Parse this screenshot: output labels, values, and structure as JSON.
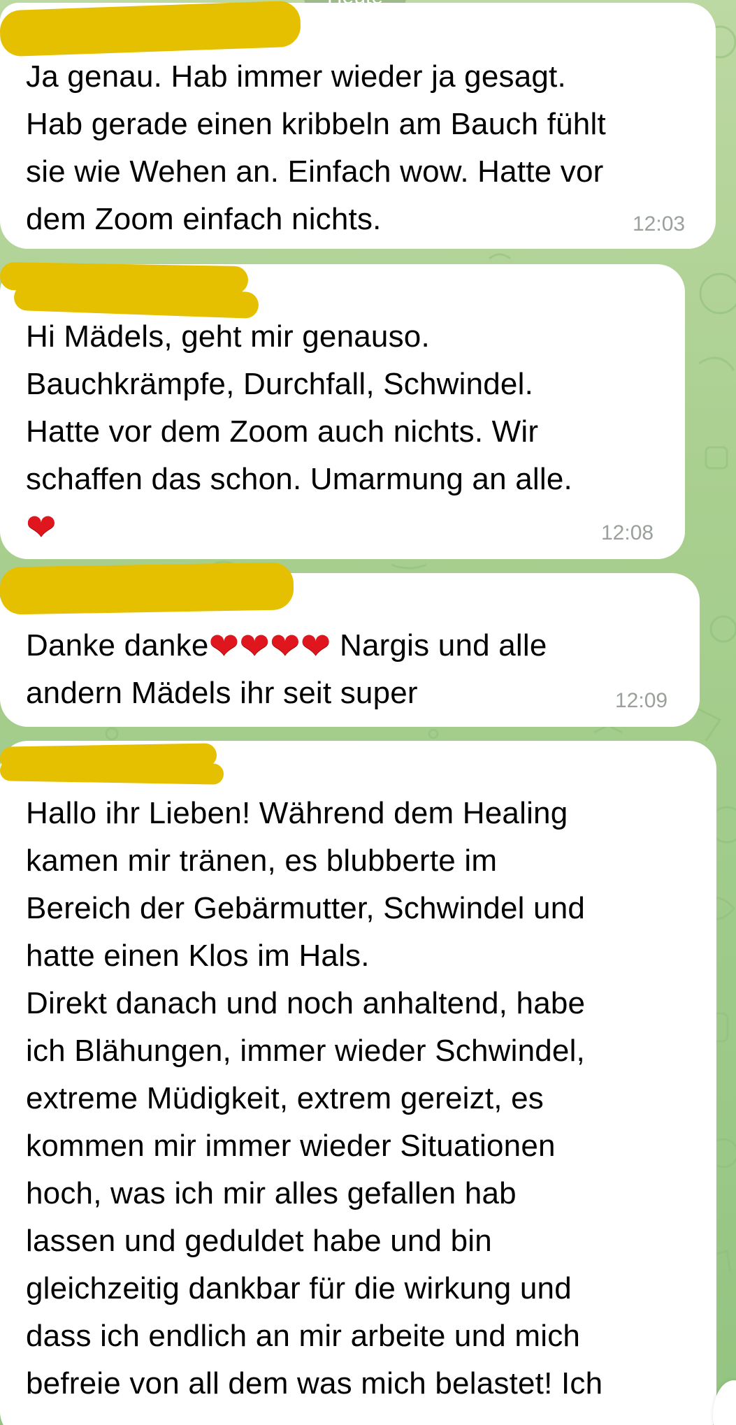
{
  "chat": {
    "background_color": "#a9cf8f",
    "bubble_color": "#ffffff",
    "redaction_color": "#e4c000",
    "header_chip_label": "Heute",
    "messages": [
      {
        "lines": [
          "Ja genau. Hab immer wieder ja gesagt.",
          "Hab gerade einen kribbeln am Bauch fühlt",
          "sie wie Wehen an. Einfach wow. Hatte vor",
          "dem Zoom einfach nichts."
        ],
        "time": "12:03"
      },
      {
        "lines": [
          "Hi Mädels, geht mir genauso.",
          "Bauchkrämpfe, Durchfall, Schwindel.",
          "Hatte vor dem Zoom auch nichts. Wir",
          "schaffen das schon. Umarmung an alle."
        ],
        "emoji": "❤",
        "time": "12:08"
      },
      {
        "line1_prefix": "Danke danke",
        "line1_hearts": "❤❤❤❤",
        "line1_suffix": " Nargis und alle",
        "line2": "andern Mädels ihr seit super",
        "time": "12:09"
      },
      {
        "lines": [
          "Hallo ihr Lieben! Während dem Healing",
          "kamen mir tränen, es blubberte im",
          "Bereich der Gebärmutter, Schwindel und",
          "hatte einen Klos im Hals.",
          "Direkt danach und noch anhaltend, habe",
          "ich Blähungen, immer wieder Schwindel,",
          "extreme Müdigkeit, extrem gereizt, es",
          "kommen mir immer wieder Situationen",
          "hoch, was ich mir alles gefallen hab",
          "lassen und geduldet habe und bin",
          "gleichzeitig dankbar für die wirkung und",
          "dass ich endlich an mir arbeite und mich",
          "befreie von all dem was mich belastet! Ich"
        ]
      }
    ]
  }
}
